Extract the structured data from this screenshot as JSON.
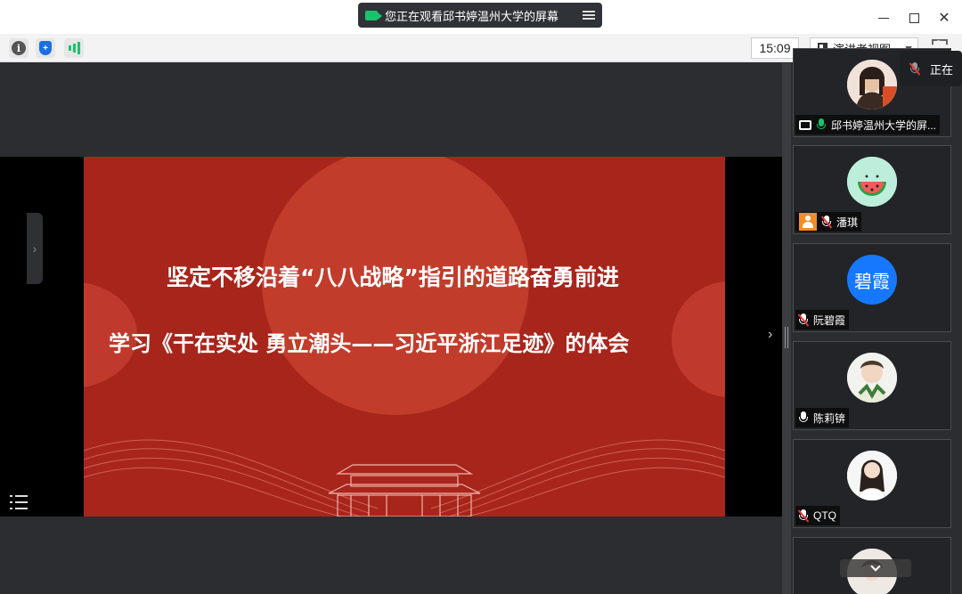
{
  "window": {
    "title": "您正在观看邱书婷温州大学的屏幕"
  },
  "toolbar": {
    "time": "15:09",
    "view_mode": "演讲者视图"
  },
  "slide": {
    "line1": "坚定不移沿着“八八战略”指引的道路奋勇前进",
    "line2": "学习《干在实处 勇立潮头——习近平浙江足迹》的体会"
  },
  "status_chip": {
    "text": "正在"
  },
  "participants": [
    {
      "name": "邱书婷温州大学的屏...",
      "mic": "on",
      "sharing": true,
      "avatar": "photo-icon"
    },
    {
      "name": "潘琪",
      "mic": "muted",
      "avatar": "watermelon-icon"
    },
    {
      "name": "阮碧霞",
      "mic": "muted",
      "avatar_text": "碧霞",
      "avatar_color": "#1677ff"
    },
    {
      "name": "陈莉锛",
      "mic": "on-white",
      "avatar": "photo-icon"
    },
    {
      "name": "QTQ",
      "mic": "muted",
      "avatar": "photo-icon"
    }
  ],
  "colors": {
    "slide_red": "#a8251c",
    "accent_green": "#19c36b",
    "muted_red": "#e53935"
  }
}
